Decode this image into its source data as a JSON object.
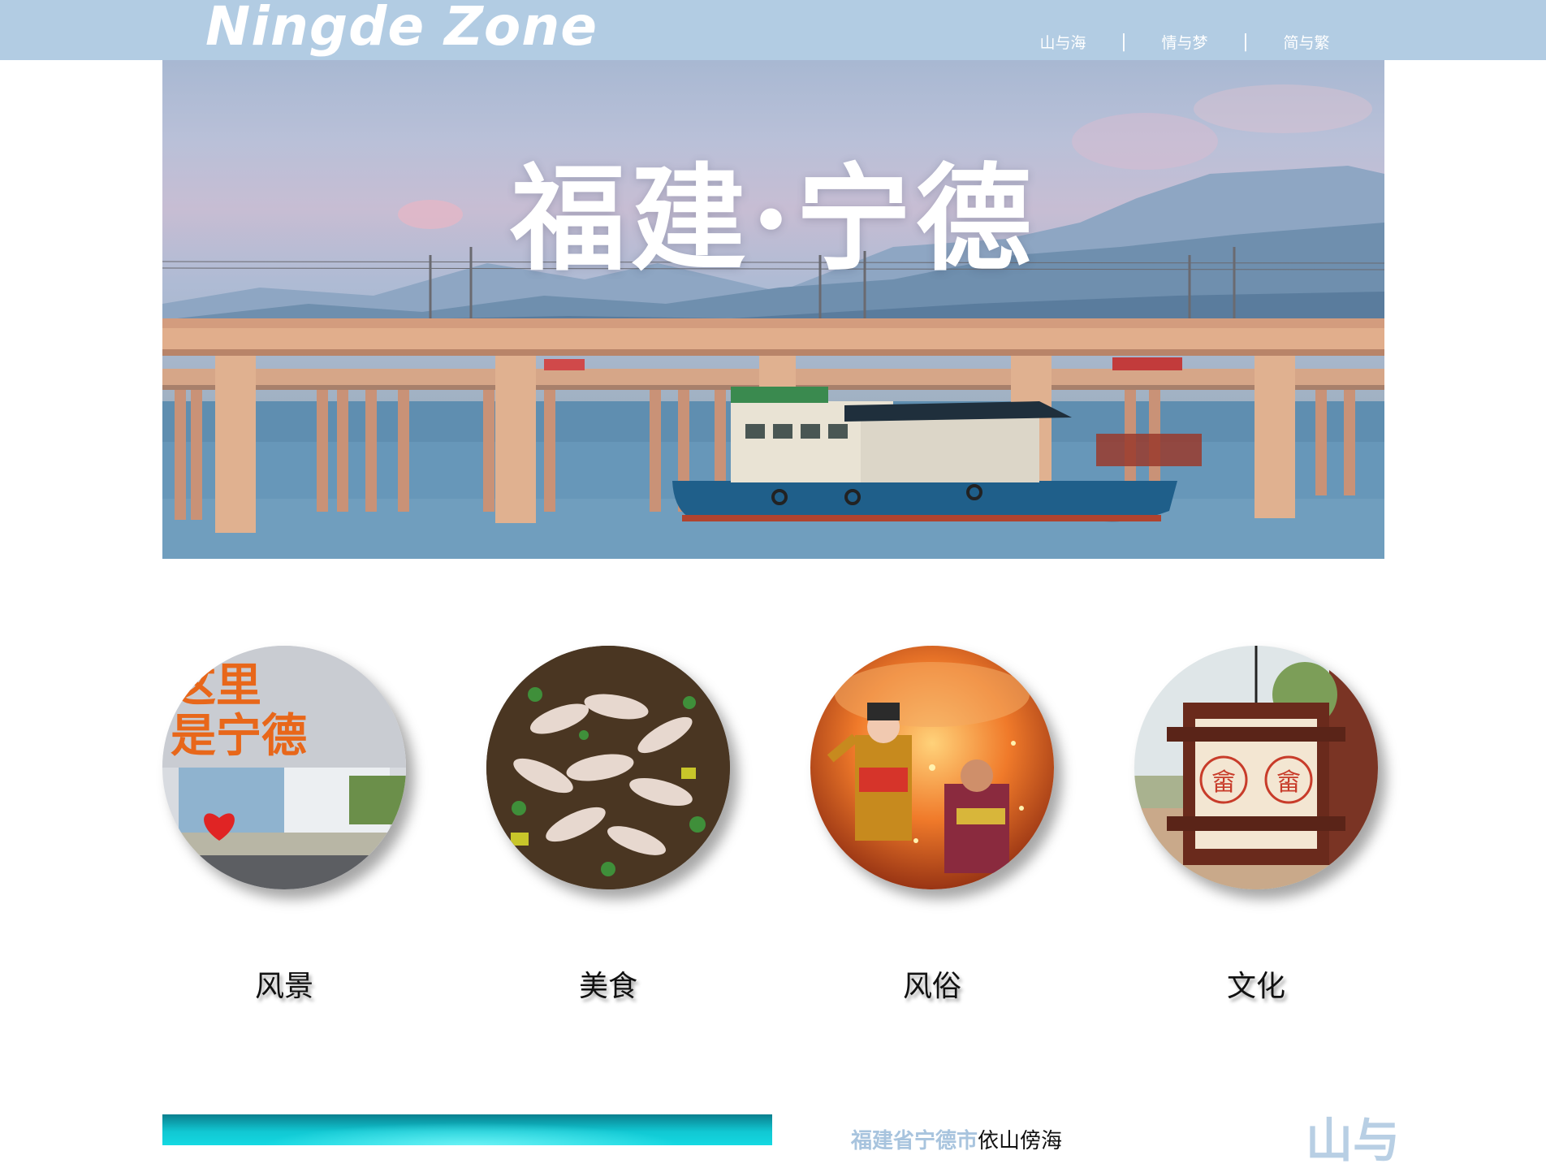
{
  "header": {
    "logo": "Ningde Zone",
    "nav": [
      {
        "label": "山与海"
      },
      {
        "label": "情与梦"
      },
      {
        "label": "简与繁"
      }
    ],
    "separator": "|"
  },
  "hero": {
    "title": "福建·宁德"
  },
  "categories": [
    {
      "label": "风景",
      "image": "ningde-sign-photo"
    },
    {
      "label": "美食",
      "image": "fish-ball-soup-photo"
    },
    {
      "label": "风俗",
      "image": "folk-performance-photo"
    },
    {
      "label": "文化",
      "image": "she-lantern-photo"
    }
  ],
  "intro": {
    "city": "福建省宁德市",
    "rest": "依山傍海"
  },
  "deco_text": "山与",
  "colors": {
    "header_bg": "#b2cce3",
    "accent_light_blue": "#a8c4de",
    "label_text": "#111111"
  }
}
